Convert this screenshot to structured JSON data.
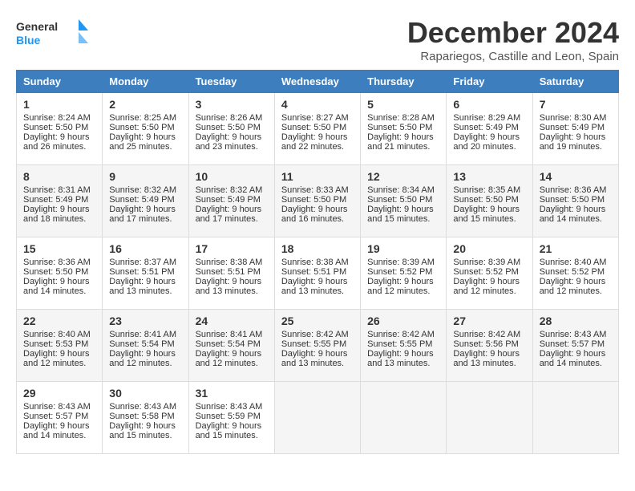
{
  "header": {
    "logo_general": "General",
    "logo_blue": "Blue",
    "title": "December 2024",
    "location": "Rapariegos, Castille and Leon, Spain"
  },
  "weekdays": [
    "Sunday",
    "Monday",
    "Tuesday",
    "Wednesday",
    "Thursday",
    "Friday",
    "Saturday"
  ],
  "weeks": [
    [
      {
        "day": "1",
        "sunrise": "Sunrise: 8:24 AM",
        "sunset": "Sunset: 5:50 PM",
        "daylight": "Daylight: 9 hours and 26 minutes."
      },
      {
        "day": "2",
        "sunrise": "Sunrise: 8:25 AM",
        "sunset": "Sunset: 5:50 PM",
        "daylight": "Daylight: 9 hours and 25 minutes."
      },
      {
        "day": "3",
        "sunrise": "Sunrise: 8:26 AM",
        "sunset": "Sunset: 5:50 PM",
        "daylight": "Daylight: 9 hours and 23 minutes."
      },
      {
        "day": "4",
        "sunrise": "Sunrise: 8:27 AM",
        "sunset": "Sunset: 5:50 PM",
        "daylight": "Daylight: 9 hours and 22 minutes."
      },
      {
        "day": "5",
        "sunrise": "Sunrise: 8:28 AM",
        "sunset": "Sunset: 5:50 PM",
        "daylight": "Daylight: 9 hours and 21 minutes."
      },
      {
        "day": "6",
        "sunrise": "Sunrise: 8:29 AM",
        "sunset": "Sunset: 5:49 PM",
        "daylight": "Daylight: 9 hours and 20 minutes."
      },
      {
        "day": "7",
        "sunrise": "Sunrise: 8:30 AM",
        "sunset": "Sunset: 5:49 PM",
        "daylight": "Daylight: 9 hours and 19 minutes."
      }
    ],
    [
      {
        "day": "8",
        "sunrise": "Sunrise: 8:31 AM",
        "sunset": "Sunset: 5:49 PM",
        "daylight": "Daylight: 9 hours and 18 minutes."
      },
      {
        "day": "9",
        "sunrise": "Sunrise: 8:32 AM",
        "sunset": "Sunset: 5:49 PM",
        "daylight": "Daylight: 9 hours and 17 minutes."
      },
      {
        "day": "10",
        "sunrise": "Sunrise: 8:32 AM",
        "sunset": "Sunset: 5:49 PM",
        "daylight": "Daylight: 9 hours and 17 minutes."
      },
      {
        "day": "11",
        "sunrise": "Sunrise: 8:33 AM",
        "sunset": "Sunset: 5:50 PM",
        "daylight": "Daylight: 9 hours and 16 minutes."
      },
      {
        "day": "12",
        "sunrise": "Sunrise: 8:34 AM",
        "sunset": "Sunset: 5:50 PM",
        "daylight": "Daylight: 9 hours and 15 minutes."
      },
      {
        "day": "13",
        "sunrise": "Sunrise: 8:35 AM",
        "sunset": "Sunset: 5:50 PM",
        "daylight": "Daylight: 9 hours and 15 minutes."
      },
      {
        "day": "14",
        "sunrise": "Sunrise: 8:36 AM",
        "sunset": "Sunset: 5:50 PM",
        "daylight": "Daylight: 9 hours and 14 minutes."
      }
    ],
    [
      {
        "day": "15",
        "sunrise": "Sunrise: 8:36 AM",
        "sunset": "Sunset: 5:50 PM",
        "daylight": "Daylight: 9 hours and 14 minutes."
      },
      {
        "day": "16",
        "sunrise": "Sunrise: 8:37 AM",
        "sunset": "Sunset: 5:51 PM",
        "daylight": "Daylight: 9 hours and 13 minutes."
      },
      {
        "day": "17",
        "sunrise": "Sunrise: 8:38 AM",
        "sunset": "Sunset: 5:51 PM",
        "daylight": "Daylight: 9 hours and 13 minutes."
      },
      {
        "day": "18",
        "sunrise": "Sunrise: 8:38 AM",
        "sunset": "Sunset: 5:51 PM",
        "daylight": "Daylight: 9 hours and 13 minutes."
      },
      {
        "day": "19",
        "sunrise": "Sunrise: 8:39 AM",
        "sunset": "Sunset: 5:52 PM",
        "daylight": "Daylight: 9 hours and 12 minutes."
      },
      {
        "day": "20",
        "sunrise": "Sunrise: 8:39 AM",
        "sunset": "Sunset: 5:52 PM",
        "daylight": "Daylight: 9 hours and 12 minutes."
      },
      {
        "day": "21",
        "sunrise": "Sunrise: 8:40 AM",
        "sunset": "Sunset: 5:52 PM",
        "daylight": "Daylight: 9 hours and 12 minutes."
      }
    ],
    [
      {
        "day": "22",
        "sunrise": "Sunrise: 8:40 AM",
        "sunset": "Sunset: 5:53 PM",
        "daylight": "Daylight: 9 hours and 12 minutes."
      },
      {
        "day": "23",
        "sunrise": "Sunrise: 8:41 AM",
        "sunset": "Sunset: 5:54 PM",
        "daylight": "Daylight: 9 hours and 12 minutes."
      },
      {
        "day": "24",
        "sunrise": "Sunrise: 8:41 AM",
        "sunset": "Sunset: 5:54 PM",
        "daylight": "Daylight: 9 hours and 12 minutes."
      },
      {
        "day": "25",
        "sunrise": "Sunrise: 8:42 AM",
        "sunset": "Sunset: 5:55 PM",
        "daylight": "Daylight: 9 hours and 13 minutes."
      },
      {
        "day": "26",
        "sunrise": "Sunrise: 8:42 AM",
        "sunset": "Sunset: 5:55 PM",
        "daylight": "Daylight: 9 hours and 13 minutes."
      },
      {
        "day": "27",
        "sunrise": "Sunrise: 8:42 AM",
        "sunset": "Sunset: 5:56 PM",
        "daylight": "Daylight: 9 hours and 13 minutes."
      },
      {
        "day": "28",
        "sunrise": "Sunrise: 8:43 AM",
        "sunset": "Sunset: 5:57 PM",
        "daylight": "Daylight: 9 hours and 14 minutes."
      }
    ],
    [
      {
        "day": "29",
        "sunrise": "Sunrise: 8:43 AM",
        "sunset": "Sunset: 5:57 PM",
        "daylight": "Daylight: 9 hours and 14 minutes."
      },
      {
        "day": "30",
        "sunrise": "Sunrise: 8:43 AM",
        "sunset": "Sunset: 5:58 PM",
        "daylight": "Daylight: 9 hours and 15 minutes."
      },
      {
        "day": "31",
        "sunrise": "Sunrise: 8:43 AM",
        "sunset": "Sunset: 5:59 PM",
        "daylight": "Daylight: 9 hours and 15 minutes."
      },
      null,
      null,
      null,
      null
    ]
  ]
}
